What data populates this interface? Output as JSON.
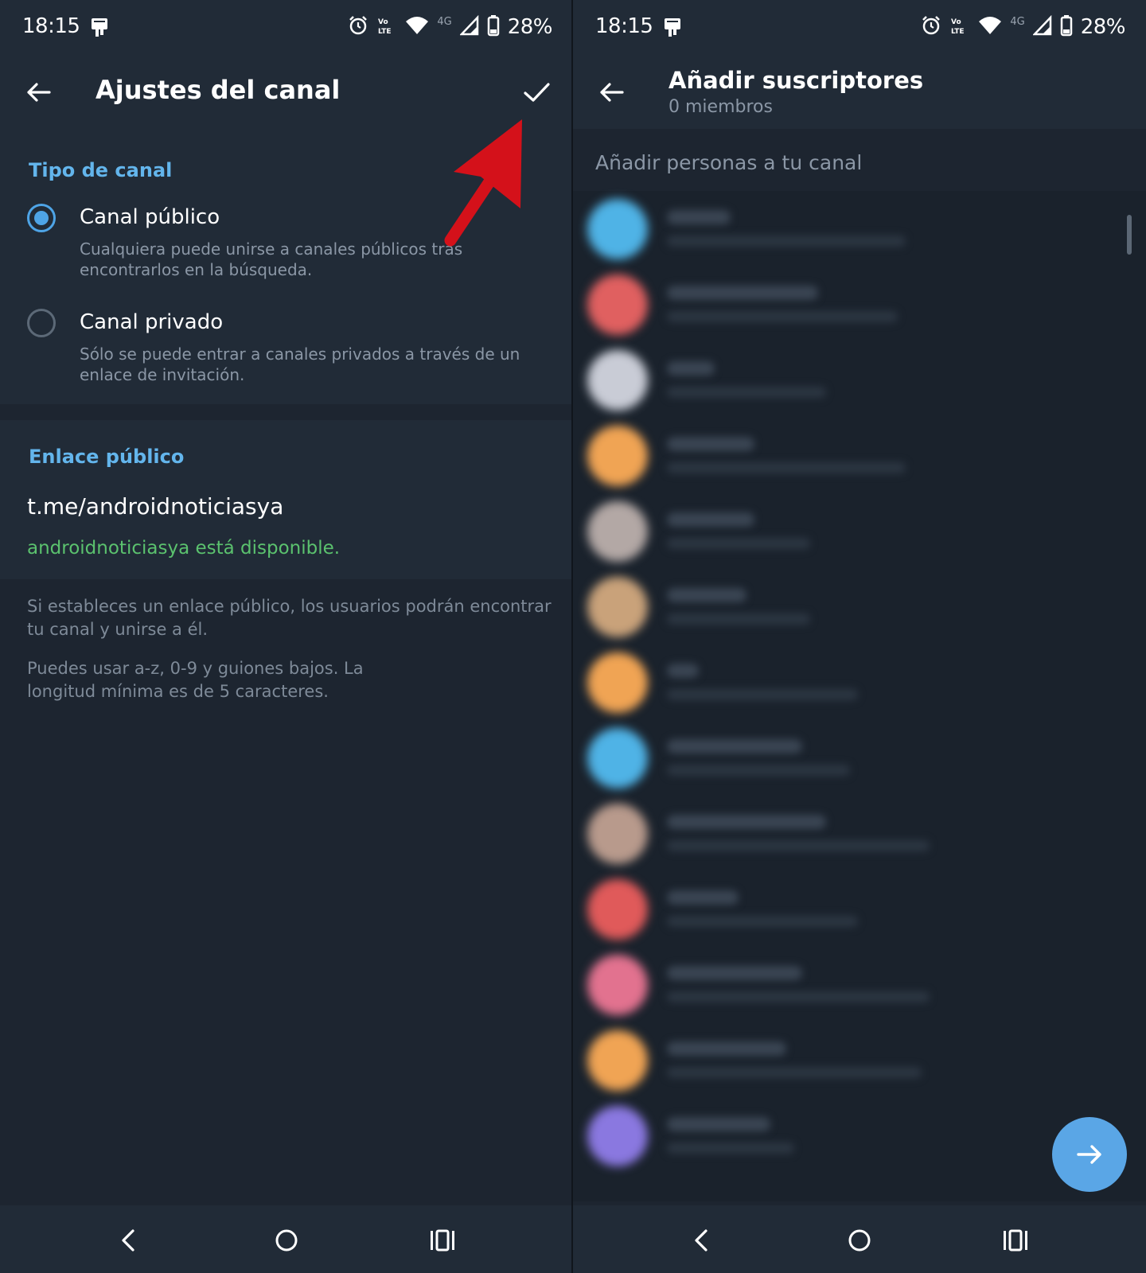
{
  "status_bar": {
    "time": "18:15",
    "battery": "28%",
    "network": "4G",
    "icons": [
      "notification-icon",
      "alarm-icon",
      "volte-icon",
      "wifi-icon",
      "signal-icon",
      "battery-icon"
    ]
  },
  "left_screen": {
    "title": "Ajustes del canal",
    "channel_type": {
      "section_title": "Tipo de canal",
      "options": [
        {
          "label": "Canal público",
          "description": "Cualquiera puede unirse a canales públicos tras encontrarlos en la búsqueda.",
          "selected": true
        },
        {
          "label": "Canal privado",
          "description": "Sólo se puede entrar a canales privados a través de un enlace de invitación.",
          "selected": false
        }
      ]
    },
    "public_link": {
      "section_title": "Enlace público",
      "value": "t.me/androidnoticiasya",
      "availability": "androidnoticiasya está disponible."
    },
    "info": [
      "Si estableces un enlace público, los usuarios podrán encontrar tu canal y unirse a él.",
      "Puedes usar a-z, 0-9 y guiones bajos. La longitud mínima es de 5 caracteres."
    ]
  },
  "right_screen": {
    "title": "Añadir suscriptores",
    "subtitle": "0 miembros",
    "hint": "Añadir personas a tu canal",
    "contact_avatar_colors": [
      "#4fb3e6",
      "#e06060",
      "#c9ccd6",
      "#f0a454",
      "#b3a8a5",
      "#c9a27a",
      "#f0a454",
      "#4fb3e6",
      "#b89a8c",
      "#e05a5a",
      "#e2728f",
      "#f0a454",
      "#8a78e0"
    ]
  },
  "colors": {
    "accent": "#4ea4e6",
    "available": "#5bc26e",
    "annotation_arrow": "#d4111a"
  }
}
